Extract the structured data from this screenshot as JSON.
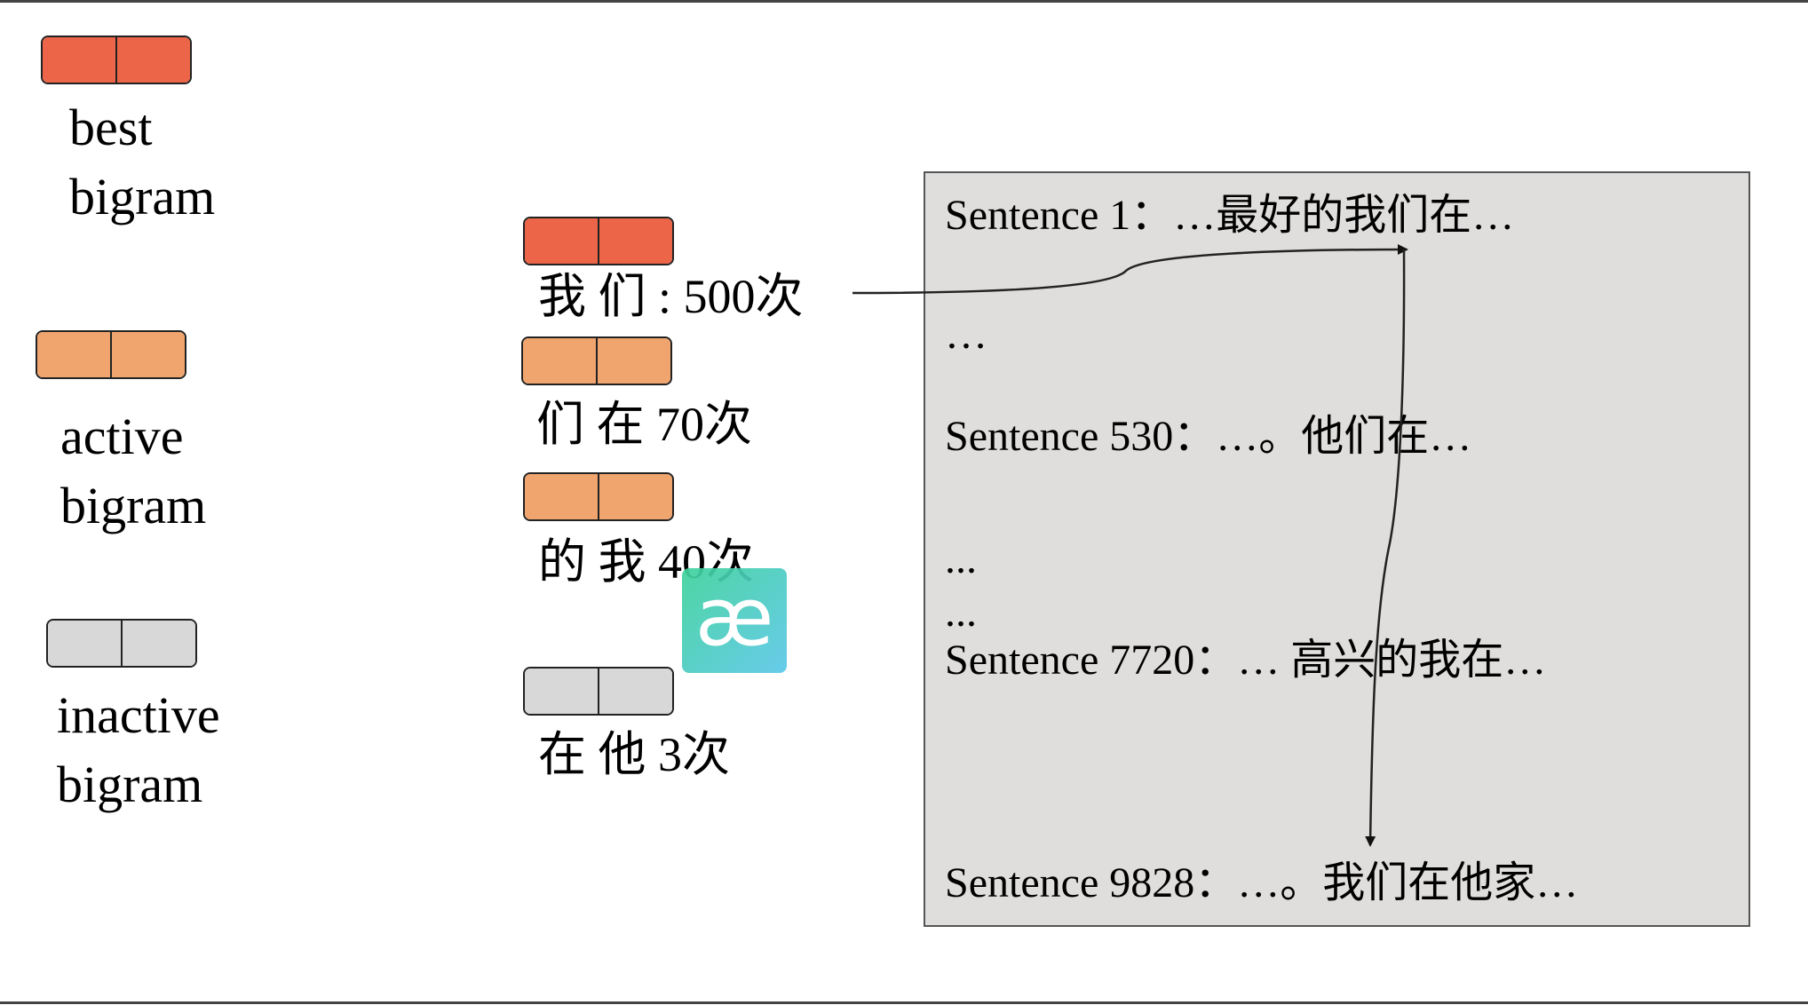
{
  "legend": {
    "best": [
      "best",
      "bigram"
    ],
    "active": [
      "active",
      "bigram"
    ],
    "inactive": [
      "inactive",
      "bigram"
    ]
  },
  "bigrams": [
    {
      "label": "我 们 : 500次",
      "kind": "best"
    },
    {
      "label": "们 在   70次",
      "kind": "active"
    },
    {
      "label": "的 我   40次",
      "kind": "active"
    },
    {
      "label": "在 他  3次",
      "kind": "inactive"
    }
  ],
  "sentences": [
    "Sentence 1：…最好的我们在…",
    "…",
    "Sentence 530：…。他们在…",
    "...",
    "...",
    "Sentence 7720：… 高兴的我在…",
    "Sentence 9828：…。我们在他家…"
  ],
  "logo": {
    "text": "æ"
  },
  "colors": {
    "best": "#ec6548",
    "active": "#f1a56e",
    "inactive": "#d8d8d8",
    "panel": "#dfdedc"
  }
}
